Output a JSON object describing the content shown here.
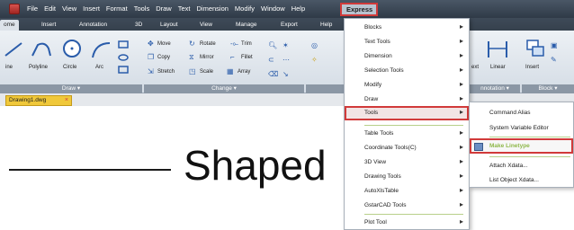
{
  "menubar": {
    "items": [
      "File",
      "Edit",
      "View",
      "Insert",
      "Format",
      "Tools",
      "Draw",
      "Text",
      "Dimension",
      "Modify",
      "Window",
      "Help"
    ],
    "express": "Express"
  },
  "tabs": [
    "ome",
    "Insert",
    "Annotation",
    "3D",
    "Layout",
    "View",
    "Manage",
    "Export",
    "Help"
  ],
  "ribbon": {
    "draw": {
      "line": "ine",
      "polyline": "Polyline",
      "circle": "Circle",
      "arc": "Arc",
      "title": "Draw"
    },
    "change": {
      "move": "Move",
      "rotate": "Rotate",
      "trim": "Trim",
      "copy": "Copy",
      "mirror": "Mirror",
      "fillet": "Fillet",
      "stretch": "Stretch",
      "scale": "Scale",
      "array": "Array",
      "title": "Change"
    },
    "right": {
      "text": "ext",
      "linear": "Linear",
      "insert": "Insert",
      "annotation_title": "nnotation",
      "block_title": "Block"
    }
  },
  "document_tab": {
    "label": "Drawing1.dwg",
    "close": "×"
  },
  "canvas": {
    "text": "Shaped"
  },
  "express_menu": {
    "items": [
      {
        "label": "Blocks",
        "arrow": "▸"
      },
      {
        "label": "Text Tools",
        "arrow": "▸"
      },
      {
        "label": "Dimension",
        "arrow": "▸"
      },
      {
        "label": "Selection Tools",
        "arrow": "▸"
      },
      {
        "label": "Modify",
        "arrow": "▸"
      },
      {
        "label": "Draw",
        "arrow": "▸"
      },
      {
        "label": "Tools",
        "arrow": "▸"
      },
      {
        "label": "Table Tools",
        "arrow": "▸"
      },
      {
        "label": "Coordinate Tools(C)",
        "arrow": "▸"
      },
      {
        "label": "3D View",
        "arrow": "▸"
      },
      {
        "label": "Drawing Tools",
        "arrow": "▸"
      },
      {
        "label": "AutoXlsTable",
        "arrow": "▸"
      },
      {
        "label": "GstarCAD Tools",
        "arrow": "▸"
      },
      {
        "label": "Plot Tool",
        "arrow": "▸"
      }
    ]
  },
  "tools_submenu": {
    "items": [
      "Command Alias",
      "System Variable Editor",
      "Make Linetype",
      "Attach Xdata...",
      "List Object Xdata..."
    ]
  },
  "colors": {
    "highlight_border": "#d13a3a",
    "accent_green": "#8fb84a"
  }
}
